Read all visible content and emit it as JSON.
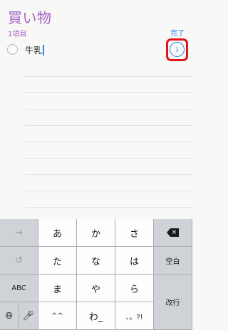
{
  "list": {
    "title": "買い物",
    "count": "1項目",
    "done_label": "完了"
  },
  "item": {
    "text": "牛乳",
    "info_glyph": "i"
  },
  "colors": {
    "accent_purple": "#a45fc6",
    "link_blue": "#2a86e6",
    "highlight_red": "#e4121a"
  },
  "keyboard": {
    "row1": {
      "arrow": "→",
      "k1": "あ",
      "k2": "か",
      "k3": "さ",
      "backspace": "×"
    },
    "row2": {
      "undo": "↺",
      "k1": "た",
      "k2": "な",
      "k3": "は",
      "space": "空白"
    },
    "row3": {
      "abc": "ABC",
      "k1": "ま",
      "k2": "や",
      "k3": "ら",
      "enter": "改行"
    },
    "row4": {
      "globe": "🌐︎",
      "mic": "🎤︎",
      "k1": "^^",
      "k2": "わ_",
      "k3": "、。?!"
    }
  }
}
